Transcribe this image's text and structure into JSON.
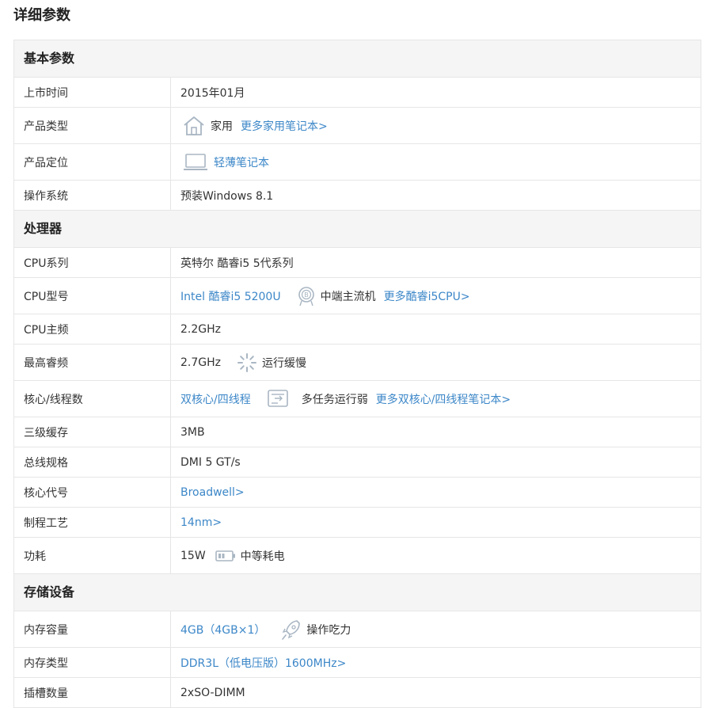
{
  "page": {
    "title": "详细参数"
  },
  "sections": [
    {
      "title": "基本参数",
      "rows": [
        {
          "key": "上市时间",
          "value": "2015年01月"
        },
        {
          "key": "产品类型",
          "value": "家用",
          "icon": "house-icon",
          "more": "更多家用笔记本>"
        },
        {
          "key": "产品定位",
          "value": "轻薄笔记本",
          "icon": "laptop-icon"
        },
        {
          "key": "操作系统",
          "value": "预装Windows 8.1"
        }
      ]
    },
    {
      "title": "处理器",
      "rows": [
        {
          "key": "CPU系列",
          "value": "英特尔 酷睿i5 5代系列"
        },
        {
          "key": "CPU型号",
          "value": "Intel 酷睿i5 5200U",
          "icon": "cpu-badge-icon",
          "note": "中端主流机",
          "more": "更多酷睿i5CPU>"
        },
        {
          "key": "CPU主频",
          "value": "2.2GHz"
        },
        {
          "key": "最高睿频",
          "value": "2.7GHz",
          "icon": "loading-spinner-icon",
          "note": "运行缓慢"
        },
        {
          "key": "核心/线程数",
          "value": "双核心/四线程",
          "icon": "multitask-icon",
          "note": "多任务运行弱",
          "more": "更多双核心/四线程笔记本>"
        },
        {
          "key": "三级缓存",
          "value": "3MB"
        },
        {
          "key": "总线规格",
          "value": "DMI 5 GT/s"
        },
        {
          "key": "核心代号",
          "value": "Broadwell>"
        },
        {
          "key": "制程工艺",
          "value": "14nm>"
        },
        {
          "key": "功耗",
          "value": "15W",
          "icon": "battery-icon",
          "note": "中等耗电"
        }
      ]
    },
    {
      "title": "存储设备",
      "rows": [
        {
          "key": "内存容量",
          "value": "4GB（4GB×1）",
          "icon": "rocket-icon",
          "note": "操作吃力"
        },
        {
          "key": "内存类型",
          "value": "DDR3L（低电压版）1600MHz>"
        },
        {
          "key": "插槽数量",
          "value": "2xSO-DIMM"
        }
      ]
    }
  ],
  "colors": {
    "link": "#3c87c8",
    "section_bg": "#f5f5f5",
    "border": "#e6e6e6",
    "icon": "#a9b6c3"
  }
}
